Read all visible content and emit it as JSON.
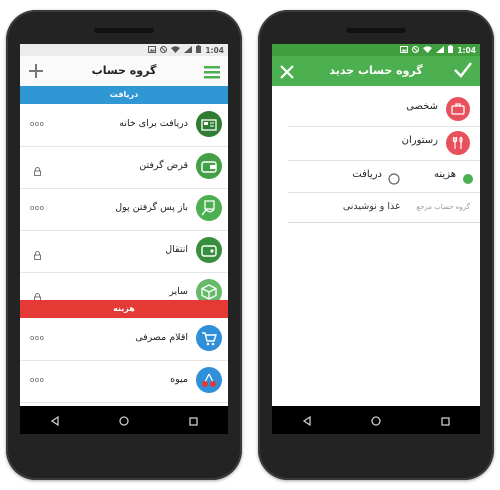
{
  "status_time": "1:04",
  "left": {
    "title": "گروه حساب",
    "income_header": "دریافت",
    "expense_header": "هزینه",
    "income_items": [
      {
        "label": "دریافت برای خانه",
        "control": "more",
        "icon": "building-icon",
        "color": "#2e7d32"
      },
      {
        "label": "قرض گرفتن",
        "control": "lock",
        "icon": "wallet-icon",
        "color": "#43a047"
      },
      {
        "label": "باز پس گرفتن پول",
        "control": "more",
        "icon": "money-hand-icon",
        "color": "#4caf50"
      },
      {
        "label": "انتقال",
        "control": "lock",
        "icon": "transfer-wallet-icon",
        "color": "#388e3c"
      },
      {
        "label": "سایر",
        "control": "lock",
        "icon": "box-icon",
        "color": "#66bb6a"
      }
    ],
    "expense_items": [
      {
        "label": "اقلام مصرفی",
        "control": "more",
        "icon": "cart-icon",
        "color": "#2f8fd8"
      },
      {
        "label": "میوه",
        "control": "more",
        "icon": "cherry-icon",
        "color": "#2f8fd8"
      }
    ],
    "more_glyph": "ooo",
    "colors": {
      "income": "#2f97d4",
      "expense": "#e53935"
    }
  },
  "right": {
    "title": "گروه حساب جدید",
    "parent_group": "شخصی",
    "group_name": "رستوران",
    "type_expense_label": "هزینه",
    "type_income_label": "دریافت",
    "parent_label": "گروه حساب مرجع",
    "parent_value": "غذا و نوشیدنی",
    "accent": "#4caf50"
  }
}
